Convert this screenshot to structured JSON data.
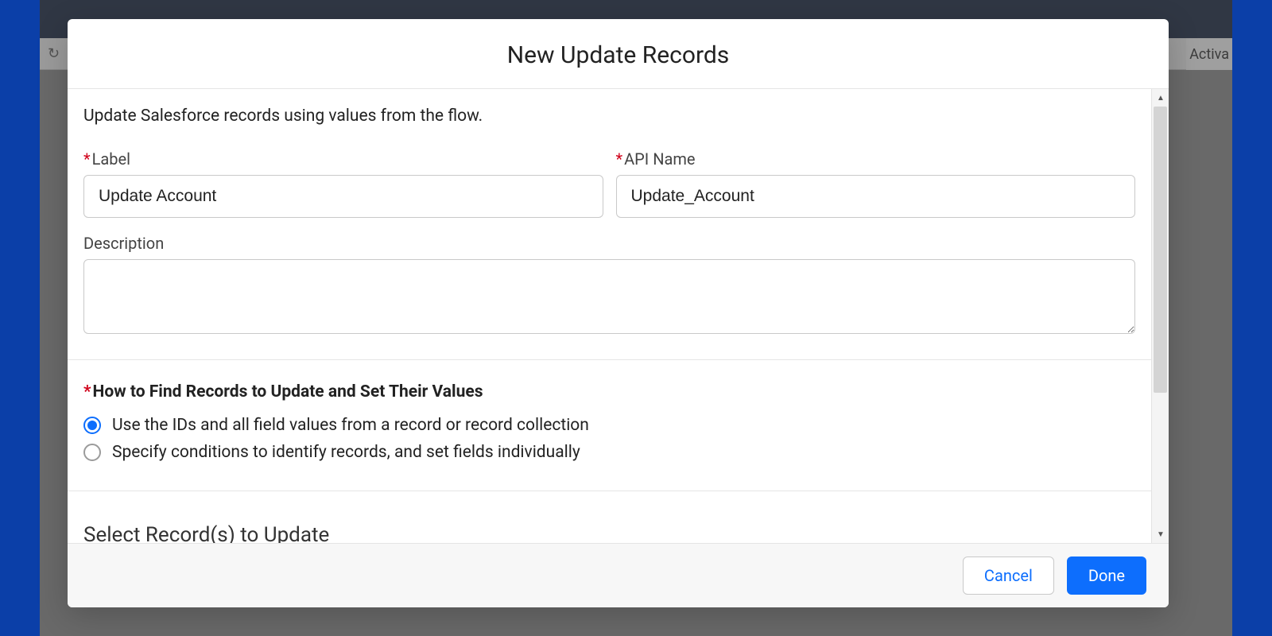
{
  "background": {
    "redo_tooltip": "Redo",
    "activate_fragment": "Activa"
  },
  "modal": {
    "title": "New Update Records",
    "help_text": "Update Salesforce records using values from the flow.",
    "fields": {
      "label_label": "Label",
      "label_value": "Update Account",
      "api_name_label": "API Name",
      "api_name_value": "Update_Account",
      "description_label": "Description",
      "description_value": ""
    },
    "how_to_find": {
      "title": "How to Find Records to Update and Set Their Values",
      "options": [
        {
          "label": "Use the IDs and all field values from a record or record collection",
          "selected": true
        },
        {
          "label": "Specify conditions to identify records, and set fields individually",
          "selected": false
        }
      ]
    },
    "select_records_title": "Select Record(s) to Update",
    "footer": {
      "cancel": "Cancel",
      "done": "Done"
    }
  }
}
